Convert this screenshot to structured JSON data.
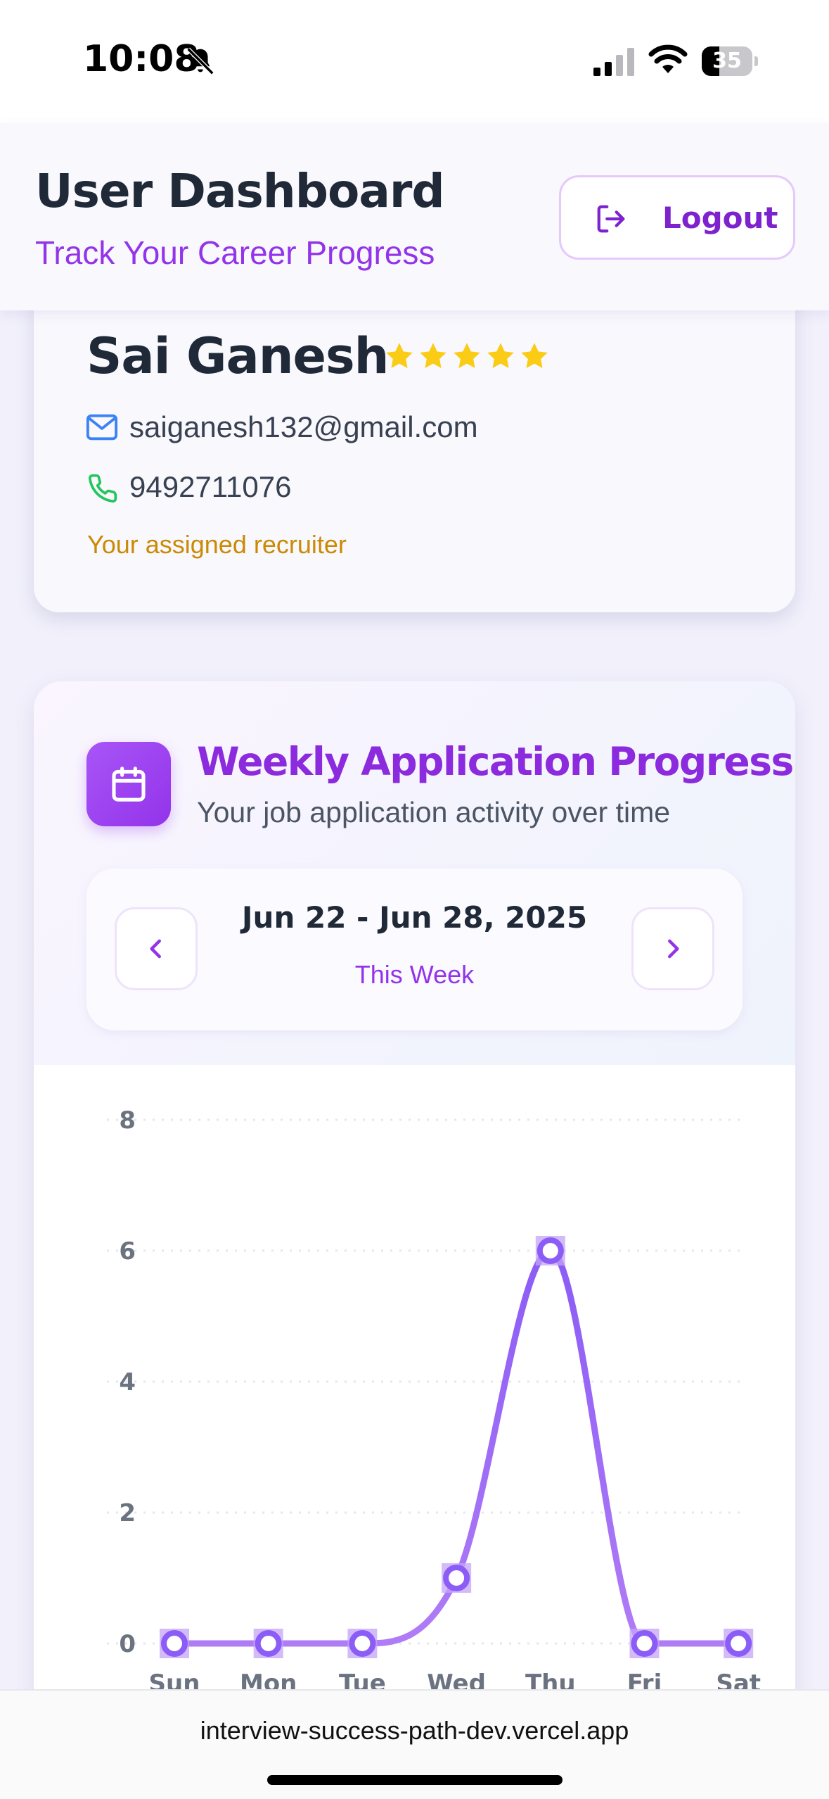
{
  "status_bar": {
    "time": "10:08",
    "battery_percent": "35",
    "battery_level": 0.35,
    "icons": [
      "bell-slash-icon",
      "cellular-signal-icon",
      "wifi-icon",
      "battery-icon"
    ]
  },
  "header": {
    "title": "User Dashboard",
    "subtitle": "Track Your Career Progress",
    "logout_label": "Logout",
    "logout_icon": "logout-icon"
  },
  "profile": {
    "name": "Sai Ganesh",
    "rating": 5,
    "email": "saiganesh132@gmail.com",
    "phone": "9492711076",
    "recruiter_note": "Your assigned recruiter"
  },
  "progress": {
    "title": "Weekly Application Progress",
    "subtitle": "Your job application activity over time",
    "week_range": "Jun 22 - Jun 28, 2025",
    "week_label": "This Week",
    "prev_icon": "chevron-left-icon",
    "next_icon": "chevron-right-icon",
    "badge_icon": "calendar-icon"
  },
  "chart_data": {
    "type": "line",
    "title": "",
    "xlabel": "",
    "ylabel": "",
    "categories": [
      "Sun",
      "Mon",
      "Tue",
      "Wed",
      "Thu",
      "Fri",
      "Sat"
    ],
    "series": [
      {
        "values": [
          0,
          0,
          0,
          1,
          6,
          0,
          0
        ]
      }
    ],
    "ylim": [
      0,
      8
    ],
    "yticks": [
      0,
      2,
      4,
      6,
      8
    ],
    "grid": true,
    "line_color": "#9f5cf0"
  },
  "browser": {
    "url": "interview-success-path-dev.vercel.app"
  },
  "colors": {
    "accent": "#9333ea",
    "recruiter": "#ca8a04",
    "star": "#facc15",
    "email_icon": "#3b82f6",
    "phone_icon": "#22c55e"
  }
}
